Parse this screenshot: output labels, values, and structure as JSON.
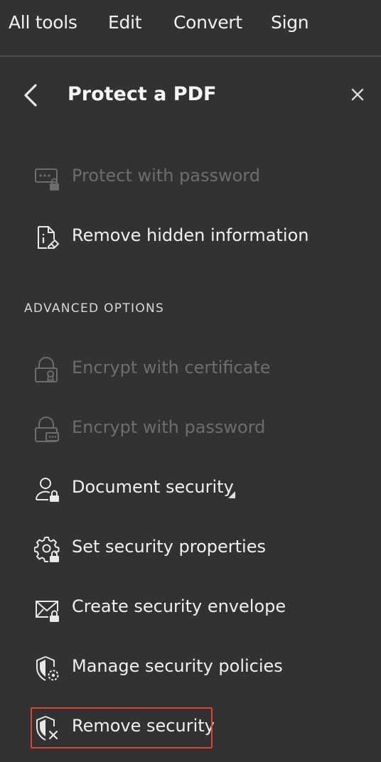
{
  "topnav": {
    "tabs": [
      {
        "label": "All tools"
      },
      {
        "label": "Edit"
      },
      {
        "label": "Convert"
      },
      {
        "label": "Sign"
      }
    ]
  },
  "panel": {
    "title": "Protect a PDF",
    "back_icon": "chevron-left-icon",
    "close_icon": "close-icon"
  },
  "basic_items": [
    {
      "label": "Protect with password",
      "icon": "password-lock-icon",
      "enabled": false
    },
    {
      "label": "Remove hidden information",
      "icon": "document-eraser-icon",
      "enabled": true
    }
  ],
  "advanced": {
    "heading": "ADVANCED OPTIONS",
    "items": [
      {
        "label": "Encrypt with certificate",
        "icon": "certificate-lock-icon",
        "enabled": false
      },
      {
        "label": "Encrypt with password",
        "icon": "password-lock-icon",
        "enabled": false
      },
      {
        "label": "Document security",
        "icon": "user-lock-icon",
        "enabled": true,
        "has_submenu": true
      },
      {
        "label": "Set security properties",
        "icon": "gear-lock-icon",
        "enabled": true
      },
      {
        "label": "Create security envelope",
        "icon": "envelope-lock-icon",
        "enabled": true
      },
      {
        "label": "Manage security policies",
        "icon": "shield-gear-icon",
        "enabled": true
      },
      {
        "label": "Remove security",
        "icon": "shield-x-icon",
        "enabled": true,
        "highlighted": true
      }
    ]
  },
  "colors": {
    "background": "#323232",
    "text": "#f0f0f0",
    "disabled_text": "#6d6d6d",
    "highlight": "#e0422e"
  }
}
